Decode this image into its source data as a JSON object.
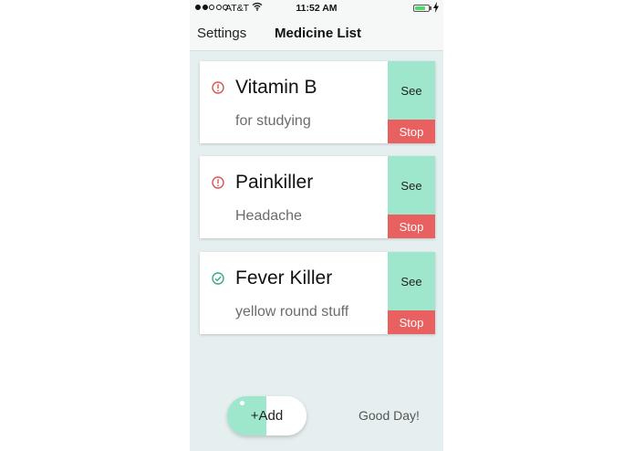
{
  "status_bar": {
    "carrier": "AT&T",
    "time": "11:52 AM",
    "signal_bars": 2,
    "signal_total": 5,
    "battery_level": 0.75,
    "colors": {
      "battery": "#4cd964"
    }
  },
  "nav": {
    "settings_label": "Settings",
    "title": "Medicine List"
  },
  "medicines": [
    {
      "name": "Vitamin B",
      "description": "for studying",
      "status": "alert",
      "see_label": "See",
      "stop_label": "Stop"
    },
    {
      "name": "Painkiller",
      "description": "Headache",
      "status": "alert",
      "see_label": "See",
      "stop_label": "Stop"
    },
    {
      "name": "Fever Killer",
      "description": "yellow round stuff",
      "status": "ok",
      "see_label": "See",
      "stop_label": "Stop"
    }
  ],
  "icons": {
    "alert": "exclamation-circle-icon",
    "ok": "check-circle-icon"
  },
  "footer": {
    "add_label": "+Add",
    "greeting": "Good Day!"
  },
  "colors": {
    "accent_green": "#9ee6cc",
    "stop_red": "#e96060",
    "alert_red": "#d9534f",
    "ok_teal": "#3aa88a",
    "background": "#e6efef"
  }
}
